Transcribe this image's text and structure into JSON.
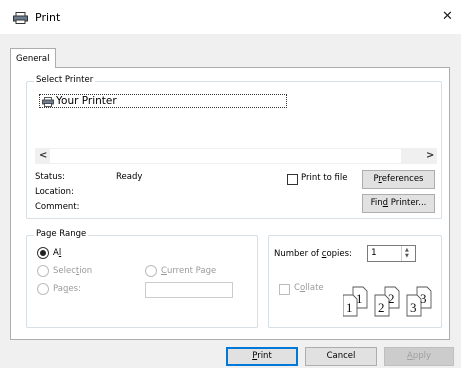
{
  "window": {
    "title": "Print",
    "close_glyph": "✕"
  },
  "tabs": [
    {
      "label": "General"
    }
  ],
  "select_printer": {
    "group_label": "Select Printer",
    "printers": [
      {
        "name": "Your Printer"
      }
    ],
    "scroll_left": "<",
    "scroll_right": ">",
    "status_label": "Status:",
    "status_value": "Ready",
    "location_label": "Location:",
    "comment_label": "Comment:",
    "print_to_file_label": "Print to file",
    "print_to_file_checked": false,
    "preferences_pre": "P",
    "preferences_key": "r",
    "preferences_post": "eferences",
    "find_pre": "Fin",
    "find_key": "d",
    "find_post": " Printer..."
  },
  "page_range": {
    "group_label": "Page Range",
    "all_label": "All",
    "all_key": "l",
    "all_pre": "A",
    "selection_pre": "Selec",
    "selection_key": "t",
    "selection_post": "ion",
    "current_pre": "",
    "current_key": "C",
    "current_post": "urrent Page",
    "pages_pre": "Pa",
    "pages_key": "g",
    "pages_post": "es:",
    "pages_value": "",
    "selected": "All"
  },
  "copies": {
    "number_pre": "Number of ",
    "number_key": "c",
    "number_post": "opies:",
    "value": "1",
    "collate_pre": "C",
    "collate_key": "o",
    "collate_post": "llate",
    "collate_checked": false,
    "collate_sheets": [
      "1",
      "1",
      "2",
      "2",
      "3",
      "3"
    ]
  },
  "footer": {
    "print_key": "P",
    "print_post": "rint",
    "cancel_label": "Cancel",
    "apply_pre": "",
    "apply_key": "A",
    "apply_post": "pply"
  }
}
